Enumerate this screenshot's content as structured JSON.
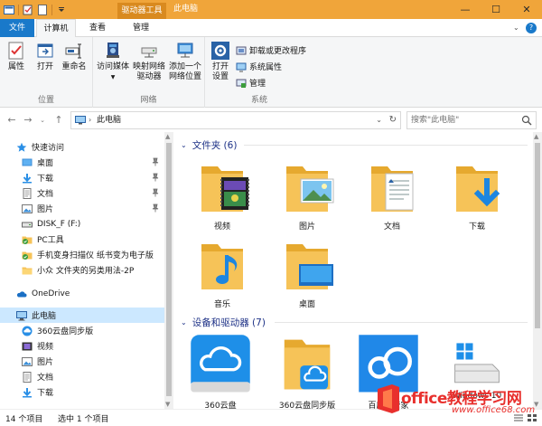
{
  "window": {
    "title": "此电脑",
    "context_tab": "驱动器工具",
    "controls": {
      "minimize": "—",
      "maximize": "☐",
      "close": "✕"
    }
  },
  "ribbon_tabs": {
    "file": "文件",
    "computer": "计算机",
    "view": "查看",
    "manage": "管理",
    "help": "?"
  },
  "ribbon": {
    "location": {
      "label": "位置",
      "properties": "属性",
      "open": "打开",
      "rename": "重命名"
    },
    "network": {
      "label": "网络",
      "access_media": "访问媒体",
      "map_drive_1": "映射网络",
      "map_drive_2": "驱动器",
      "add_location_1": "添加一个",
      "add_location_2": "网络位置"
    },
    "system": {
      "label": "系统",
      "open_settings_1": "打开",
      "open_settings_2": "设置",
      "uninstall": "卸载或更改程序",
      "system_properties": "系统属性",
      "manage": "管理"
    }
  },
  "address": {
    "path": "此电脑",
    "search_placeholder": "搜索\"此电脑\""
  },
  "nav": {
    "items": [
      {
        "label": "快速访问",
        "icon": "star-icon"
      },
      {
        "label": "桌面",
        "icon": "desktop-icon",
        "pinned": true
      },
      {
        "label": "下载",
        "icon": "download-icon",
        "pinned": true
      },
      {
        "label": "文档",
        "icon": "document-icon",
        "pinned": true
      },
      {
        "label": "图片",
        "icon": "picture-icon",
        "pinned": true
      },
      {
        "label": "DISK_F (F:)",
        "icon": "drive-icon"
      },
      {
        "label": "PC工具",
        "icon": "folder-check-icon"
      },
      {
        "label": "手机变身扫描仪 纸书变为电子版",
        "icon": "folder-check-icon"
      },
      {
        "label": "小众 文件夹的另类用法-2P",
        "icon": "folder-icon"
      },
      {
        "label": "OneDrive",
        "icon": "cloud-icon"
      },
      {
        "label": "此电脑",
        "icon": "pc-icon",
        "selected": true
      },
      {
        "label": "360云盘同步版",
        "icon": "cloud-sync-icon"
      },
      {
        "label": "视频",
        "icon": "video-icon"
      },
      {
        "label": "图片",
        "icon": "picture-icon"
      },
      {
        "label": "文档",
        "icon": "document-icon"
      },
      {
        "label": "下载",
        "icon": "download-icon"
      }
    ]
  },
  "content": {
    "folders_header": "文件夹 (6)",
    "folders": [
      {
        "label": "视频",
        "icon": "video-folder-icon"
      },
      {
        "label": "图片",
        "icon": "picture-folder-icon"
      },
      {
        "label": "文档",
        "icon": "document-folder-icon"
      },
      {
        "label": "下载",
        "icon": "download-folder-icon"
      },
      {
        "label": "音乐",
        "icon": "music-folder-icon"
      },
      {
        "label": "桌面",
        "icon": "desktop-folder-icon"
      }
    ],
    "devices_header": "设备和驱动器 (7)",
    "devices": [
      {
        "label": "360云盘",
        "icon": "360-cloud-icon"
      },
      {
        "label": "360云盘同步版",
        "icon": "360-cloud-sync-folder-icon"
      },
      {
        "label": "百度云管家",
        "icon": "baidu-cloud-icon"
      },
      {
        "label": "Windows 10",
        "icon": "windows-drive-icon"
      }
    ]
  },
  "status": {
    "item_count": "14 个项目",
    "selection": "选中 1 个项目"
  },
  "watermark": {
    "text": "office教程学习网",
    "url": "www.office68.com"
  },
  "colors": {
    "title_bar": "#f0a53a",
    "file_tab": "#1979ca",
    "selection": "#cce8ff",
    "section_header": "#1e3287",
    "folder": "#f6c358"
  }
}
